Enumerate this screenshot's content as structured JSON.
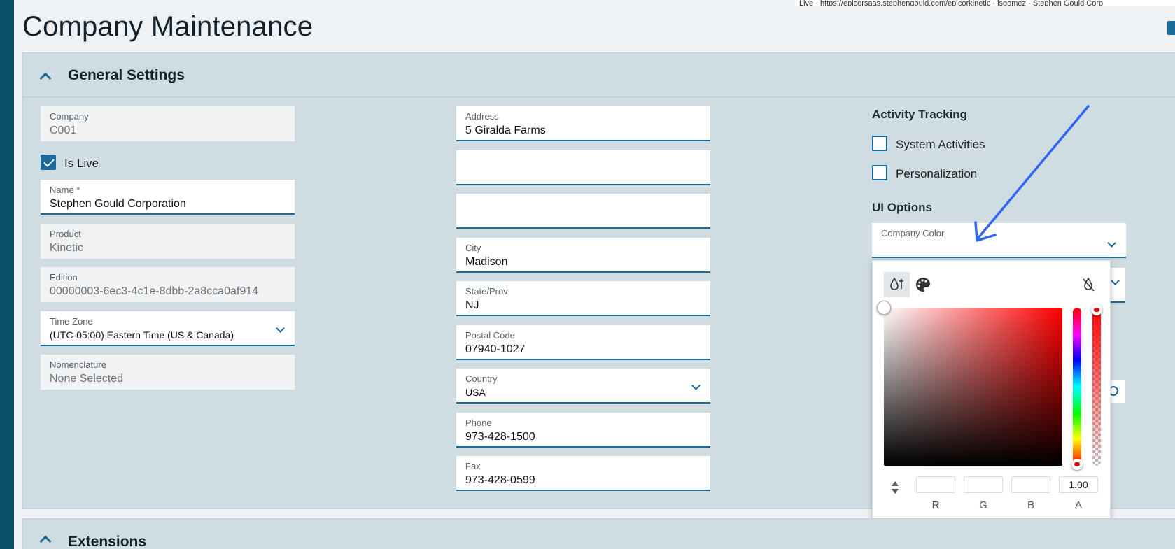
{
  "page": {
    "title": "Company Maintenance"
  },
  "top_url_fragment": "Live · https://epicorsaas.stephengould.com/epicorkinetic · jsgomez · Stephen Gould Corp",
  "general_settings": {
    "section_title": "General Settings",
    "column1": {
      "company": {
        "label": "Company",
        "value": "C001"
      },
      "is_live": {
        "label": "Is Live",
        "checked": true
      },
      "name": {
        "label": "Name *",
        "value": "Stephen Gould Corporation"
      },
      "product": {
        "label": "Product",
        "value": "Kinetic"
      },
      "edition": {
        "label": "Edition",
        "value": "00000003-6ec3-4c1e-8dbb-2a8cca0af914"
      },
      "time_zone": {
        "label": "Time Zone",
        "value": "(UTC-05:00) Eastern Time (US & Canada)"
      },
      "nomenclature": {
        "label": "Nomenclature",
        "value": "None Selected"
      }
    },
    "column2": {
      "address": {
        "label": "Address",
        "value": "5 Giralda Farms"
      },
      "address2": {
        "value": ""
      },
      "address3": {
        "value": ""
      },
      "city": {
        "label": "City",
        "value": "Madison"
      },
      "state": {
        "label": "State/Prov",
        "value": "NJ"
      },
      "postal": {
        "label": "Postal Code",
        "value": "07940-1027"
      },
      "country": {
        "label": "Country",
        "value": "USA"
      },
      "phone": {
        "label": "Phone",
        "value": "973-428-1500"
      },
      "fax": {
        "label": "Fax",
        "value": "973-428-0599"
      }
    },
    "column3": {
      "activity_tracking": {
        "heading": "Activity Tracking",
        "system_activities": {
          "label": "System Activities",
          "checked": false
        },
        "personalization": {
          "label": "Personalization",
          "checked": false
        }
      },
      "ui_options": {
        "heading": "UI Options",
        "company_color": {
          "label": "Company Color",
          "value": ""
        }
      }
    }
  },
  "color_picker": {
    "mode_icons": [
      "color-drop-icon",
      "palette-icon"
    ],
    "no_color_icon": "no-color-icon",
    "r": "",
    "g": "",
    "b": "",
    "a": "1.00",
    "labels": {
      "r": "R",
      "g": "G",
      "b": "B",
      "a": "A"
    },
    "hue_color": "#ff0000"
  },
  "extensions": {
    "section_title": "Extensions"
  },
  "colors": {
    "accent": "#1a6a9a",
    "panel": "#cfdde3",
    "rail": "#0b4f66",
    "annotation_arrow": "#3366ee"
  }
}
